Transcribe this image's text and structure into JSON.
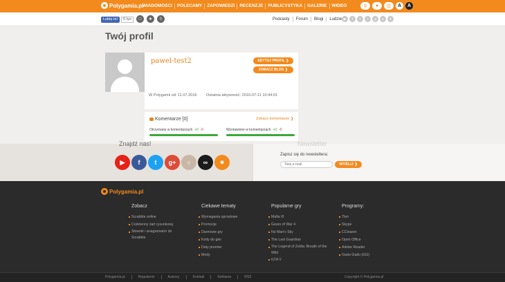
{
  "topbar": {
    "logo": "Polygamia.pl",
    "nav": [
      "WIADOMOŚCI",
      "POLECAMY",
      "ZAPOWIEDZI",
      "RECENZJE",
      "PUBLICYSTYKA",
      "GALERIE",
      "WIDEO"
    ],
    "contrast_a_dark": "A",
    "contrast_a_light": "A"
  },
  "subbar": {
    "fb_like": "Lubię to!",
    "fb_count": "0 tys",
    "links": [
      "Podcasty",
      "Forum",
      "Blogi",
      "Ludzie"
    ]
  },
  "profile": {
    "page_title": "Twój profil",
    "username": "pawel-test2",
    "edit_button": "EDYTUJ PROFIL",
    "blog_button": "ZOBACZ BLOG",
    "member_since": "W Polygamii od: 11.07.2016",
    "last_activity": "Ostatnia aktywność: 2016-07-11 10:44:01"
  },
  "comments": {
    "title": "Komentarze",
    "count": "[0]",
    "see_link": "Zobacz komentarze",
    "received_label": "Otrzymane w komentarzach",
    "received_plus": "+0",
    "received_minus": "-0",
    "received_bar": 1.0,
    "given_label": "Wystawione w komentarzach",
    "given_plus": "+0",
    "given_minus": "-0",
    "given_bar": 1.0
  },
  "social": {
    "heading_partial": "Znajdź nas!",
    "newsletter_heading_partial": "Newsletter",
    "newsletter_label": "Zapisz się do newslettera:",
    "email_placeholder": "Twój e-mail",
    "send_button": "WYŚLIJ",
    "colors": {
      "youtube": "#e62117",
      "facebook": "#3b5998",
      "twitter": "#1da1f2",
      "googleplus": "#dd4b39",
      "instagram": "#c9b7a6",
      "steam": "#1b1b1b",
      "rss": "#f28a1d"
    }
  },
  "footer": {
    "logo": "Polygamia.pl",
    "columns": [
      {
        "title": "Zobacz",
        "items": [
          "Scrabble online",
          "Codzienny żart rysunkowy",
          "Słownik i anagramator do Scrabble"
        ]
      },
      {
        "title": "Ciekawe tematy",
        "items": [
          "Wymagania sprzętowe",
          "Promocje",
          "Darmowe gry",
          "Kody do gier",
          "Daty premier",
          "Mody"
        ]
      },
      {
        "title": "Popularne gry",
        "items": [
          "Mafia III",
          "Gears of War 4",
          "No Man's Sky",
          "The Last Guardian",
          "The Legend of Zelda: Breath of the Wild",
          "GTA V"
        ]
      },
      {
        "title": "Programy:",
        "items": [
          "Tlen",
          "Skype",
          "CCleaner",
          "Open Office",
          "Adobe Reader",
          "Gadu-Gadu (GG)"
        ]
      }
    ],
    "bottom_links": [
      "Polygamia.pl",
      "Regulamin",
      "Autorzy",
      "Kontakt",
      "Reklama",
      "RSS"
    ],
    "copyright": "Copyright © Polygamia.pl"
  },
  "accent": "#f28a1d"
}
